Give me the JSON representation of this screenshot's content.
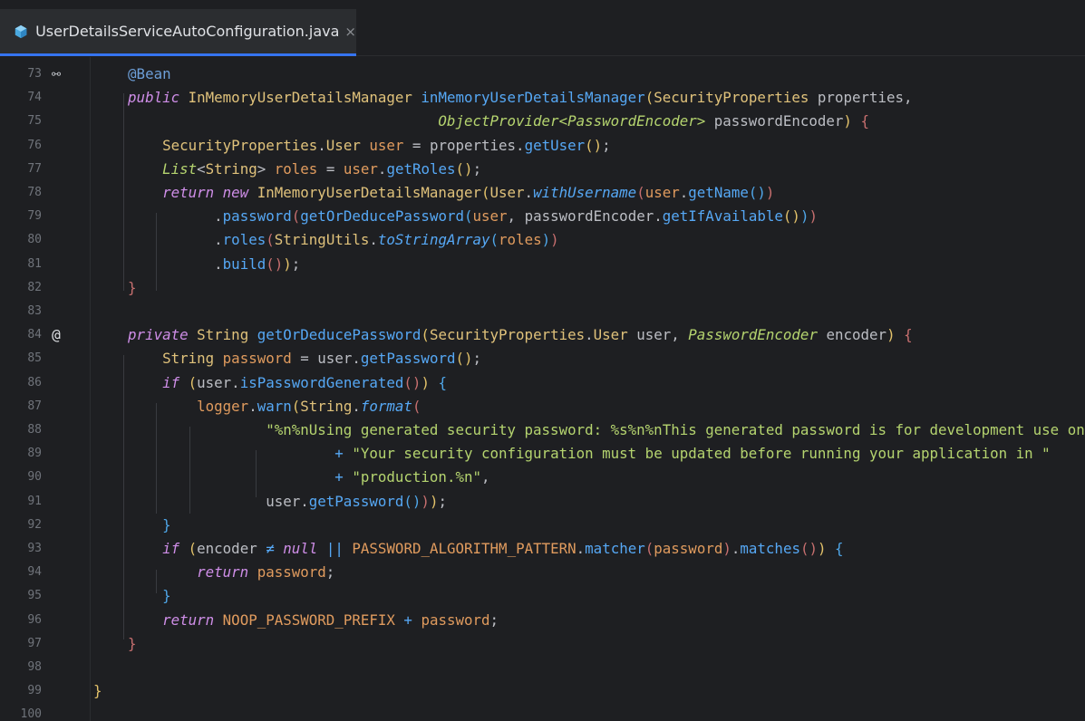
{
  "tab": {
    "filename": "UserDetailsServiceAutoConfiguration.java",
    "close_glyph": "×"
  },
  "gutter": {
    "bean_icon_glyph": "⚯",
    "override_icon_glyph": "@"
  },
  "lines": [
    {
      "n": "73",
      "mark": "bean",
      "indent": 0,
      "tokens": [
        [
          "a",
          "    @Bean"
        ]
      ]
    },
    {
      "n": "74",
      "mark": "",
      "tokens": [
        [
          "k",
          "    public "
        ],
        [
          "t",
          "InMemoryUserDetailsManager "
        ],
        [
          "m",
          "inMemoryUserDetailsManager"
        ],
        [
          "p1",
          "("
        ],
        [
          "t",
          "SecurityProperties "
        ],
        [
          "w",
          "properties,"
        ]
      ]
    },
    {
      "n": "75",
      "mark": "",
      "tokens": [
        [
          "w",
          "                                        "
        ],
        [
          "g",
          "ObjectProvider<PasswordEncoder>"
        ],
        [
          "w",
          " passwordEncoder"
        ],
        [
          "p1",
          ")"
        ],
        [
          "w",
          " "
        ],
        [
          "p2",
          "{"
        ]
      ]
    },
    {
      "n": "76",
      "mark": "",
      "tokens": [
        [
          "t",
          "        SecurityProperties"
        ],
        [
          "w",
          "."
        ],
        [
          "t",
          "User "
        ],
        [
          "v",
          "user"
        ],
        [
          "w",
          " = properties."
        ],
        [
          "m",
          "getUser"
        ],
        [
          "p1",
          "()"
        ],
        [
          "w",
          ";"
        ]
      ]
    },
    {
      "n": "77",
      "mark": "",
      "tokens": [
        [
          "g",
          "        List"
        ],
        [
          "w",
          "<"
        ],
        [
          "t",
          "String"
        ],
        [
          "w",
          "> "
        ],
        [
          "v",
          "roles"
        ],
        [
          "w",
          " = "
        ],
        [
          "v",
          "user"
        ],
        [
          "w",
          "."
        ],
        [
          "m",
          "getRoles"
        ],
        [
          "p1",
          "()"
        ],
        [
          "w",
          ";"
        ]
      ]
    },
    {
      "n": "78",
      "mark": "",
      "tokens": [
        [
          "k",
          "        return new "
        ],
        [
          "t",
          "InMemoryUserDetailsManager"
        ],
        [
          "p1",
          "("
        ],
        [
          "t",
          "User"
        ],
        [
          "w",
          "."
        ],
        [
          "m",
          "i:withUsername"
        ],
        [
          "p2",
          "("
        ],
        [
          "v",
          "user"
        ],
        [
          "w",
          "."
        ],
        [
          "m",
          "getName"
        ],
        [
          "p3",
          "()"
        ],
        [
          "p2",
          ")"
        ]
      ]
    },
    {
      "n": "79",
      "mark": "",
      "tokens": [
        [
          "w",
          "              ."
        ],
        [
          "m",
          "password"
        ],
        [
          "p2",
          "("
        ],
        [
          "m",
          "getOrDeducePassword"
        ],
        [
          "p3",
          "("
        ],
        [
          "v",
          "user"
        ],
        [
          "w",
          ", passwordEncoder."
        ],
        [
          "m",
          "getIfAvailable"
        ],
        [
          "p1",
          "()"
        ],
        [
          "p3",
          ")"
        ],
        [
          "p2",
          ")"
        ]
      ]
    },
    {
      "n": "80",
      "mark": "",
      "tokens": [
        [
          "w",
          "              ."
        ],
        [
          "m",
          "roles"
        ],
        [
          "p2",
          "("
        ],
        [
          "t",
          "StringUtils"
        ],
        [
          "w",
          "."
        ],
        [
          "m",
          "i:toStringArray"
        ],
        [
          "p3",
          "("
        ],
        [
          "v",
          "roles"
        ],
        [
          "p3",
          ")"
        ],
        [
          "p2",
          ")"
        ]
      ]
    },
    {
      "n": "81",
      "mark": "",
      "tokens": [
        [
          "w",
          "              ."
        ],
        [
          "m",
          "build"
        ],
        [
          "p2",
          "()"
        ],
        [
          "p1",
          ")"
        ],
        [
          "w",
          ";"
        ]
      ]
    },
    {
      "n": "82",
      "mark": "",
      "tokens": [
        [
          "p2",
          "    }"
        ]
      ]
    },
    {
      "n": "83",
      "mark": "",
      "tokens": []
    },
    {
      "n": "84",
      "mark": "override",
      "tokens": [
        [
          "k",
          "    private "
        ],
        [
          "t",
          "String "
        ],
        [
          "m",
          "getOrDeducePassword"
        ],
        [
          "p1",
          "("
        ],
        [
          "t",
          "SecurityProperties"
        ],
        [
          "w",
          "."
        ],
        [
          "t",
          "User "
        ],
        [
          "w",
          "user, "
        ],
        [
          "g",
          "PasswordEncoder"
        ],
        [
          "w",
          " encoder"
        ],
        [
          "p1",
          ")"
        ],
        [
          "w",
          " "
        ],
        [
          "p2",
          "{"
        ]
      ]
    },
    {
      "n": "85",
      "mark": "",
      "tokens": [
        [
          "t",
          "        String "
        ],
        [
          "v",
          "password"
        ],
        [
          "w",
          " = user."
        ],
        [
          "m",
          "getPassword"
        ],
        [
          "p1",
          "()"
        ],
        [
          "w",
          ";"
        ]
      ]
    },
    {
      "n": "86",
      "mark": "",
      "tokens": [
        [
          "k",
          "        if "
        ],
        [
          "p1",
          "("
        ],
        [
          "w",
          "user."
        ],
        [
          "m",
          "isPasswordGenerated"
        ],
        [
          "p2",
          "()"
        ],
        [
          "p1",
          ")"
        ],
        [
          "w",
          " "
        ],
        [
          "p3",
          "{"
        ]
      ]
    },
    {
      "n": "87",
      "mark": "",
      "tokens": [
        [
          "v",
          "            logger"
        ],
        [
          "w",
          "."
        ],
        [
          "m",
          "warn"
        ],
        [
          "p1",
          "("
        ],
        [
          "t",
          "String"
        ],
        [
          "w",
          "."
        ],
        [
          "m",
          "i:format"
        ],
        [
          "p2",
          "("
        ]
      ]
    },
    {
      "n": "88",
      "mark": "",
      "tokens": [
        [
          "s",
          "                    \"%n%nUsing generated security password: %s%n%nThis generated password is for development use only. \""
        ]
      ]
    },
    {
      "n": "89",
      "mark": "",
      "tokens": [
        [
          "w",
          "                            "
        ],
        [
          "m",
          "+ "
        ],
        [
          "s",
          "\"Your security configuration must be updated before running your application in \""
        ]
      ]
    },
    {
      "n": "90",
      "mark": "",
      "tokens": [
        [
          "w",
          "                            "
        ],
        [
          "m",
          "+ "
        ],
        [
          "s",
          "\"production.%n\""
        ],
        [
          "w",
          ","
        ]
      ]
    },
    {
      "n": "91",
      "mark": "",
      "tokens": [
        [
          "w",
          "                    user."
        ],
        [
          "m",
          "getPassword"
        ],
        [
          "p3",
          "()"
        ],
        [
          "p2",
          ")"
        ],
        [
          "p1",
          ")"
        ],
        [
          "w",
          ";"
        ]
      ]
    },
    {
      "n": "92",
      "mark": "",
      "tokens": [
        [
          "p3",
          "        }"
        ]
      ]
    },
    {
      "n": "93",
      "mark": "",
      "tokens": [
        [
          "k",
          "        if "
        ],
        [
          "p1",
          "("
        ],
        [
          "w",
          "encoder "
        ],
        [
          "m",
          "≠ "
        ],
        [
          "k",
          "null "
        ],
        [
          "m",
          "|| "
        ],
        [
          "v",
          "PASSWORD_ALGORITHM_PATTERN"
        ],
        [
          "w",
          "."
        ],
        [
          "m",
          "matcher"
        ],
        [
          "p2",
          "("
        ],
        [
          "v",
          "password"
        ],
        [
          "p2",
          ")"
        ],
        [
          "w",
          "."
        ],
        [
          "m",
          "matches"
        ],
        [
          "p2",
          "()"
        ],
        [
          "p1",
          ")"
        ],
        [
          "w",
          " "
        ],
        [
          "p3",
          "{"
        ]
      ]
    },
    {
      "n": "94",
      "mark": "",
      "tokens": [
        [
          "k",
          "            return "
        ],
        [
          "v",
          "password"
        ],
        [
          "w",
          ";"
        ]
      ]
    },
    {
      "n": "95",
      "mark": "",
      "tokens": [
        [
          "p3",
          "        }"
        ]
      ]
    },
    {
      "n": "96",
      "mark": "",
      "tokens": [
        [
          "k",
          "        return "
        ],
        [
          "v",
          "NOOP_PASSWORD_PREFIX"
        ],
        [
          "m",
          " + "
        ],
        [
          "v",
          "password"
        ],
        [
          "w",
          ";"
        ]
      ]
    },
    {
      "n": "97",
      "mark": "",
      "tokens": [
        [
          "p2",
          "    }"
        ]
      ]
    },
    {
      "n": "98",
      "mark": "",
      "tokens": []
    },
    {
      "n": "99",
      "mark": "",
      "tokens": [
        [
          "p1",
          "}"
        ]
      ]
    },
    {
      "n": "100",
      "mark": "",
      "tokens": []
    }
  ]
}
